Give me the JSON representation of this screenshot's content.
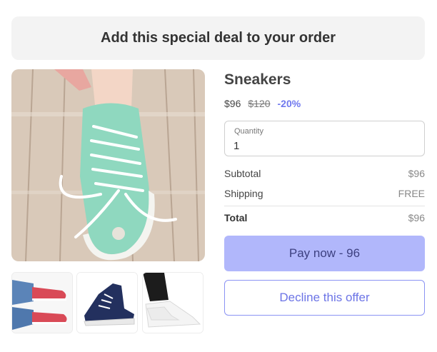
{
  "banner": {
    "title": "Add this special deal to your order"
  },
  "product": {
    "name": "Sneakers",
    "price": "$96",
    "original_price": "$120",
    "discount": "-20%",
    "main_image": "mint-green-high-top-sneaker-on-wood-floor",
    "thumbnails": [
      "red-sneakers-with-jeans",
      "navy-high-top-sneaker",
      "white-sneakers-with-black-jeans"
    ]
  },
  "quantity": {
    "label": "Quantity",
    "value": "1"
  },
  "summary": {
    "subtotal_label": "Subtotal",
    "subtotal_value": "$96",
    "shipping_label": "Shipping",
    "shipping_value": "FREE",
    "total_label": "Total",
    "total_value": "$96"
  },
  "actions": {
    "pay_label": "Pay now - 96",
    "decline_label": "Decline this offer"
  },
  "colors": {
    "accent": "#6f78ee",
    "pay_button": "#b1b7fb",
    "banner_bg": "#f3f3f3"
  }
}
